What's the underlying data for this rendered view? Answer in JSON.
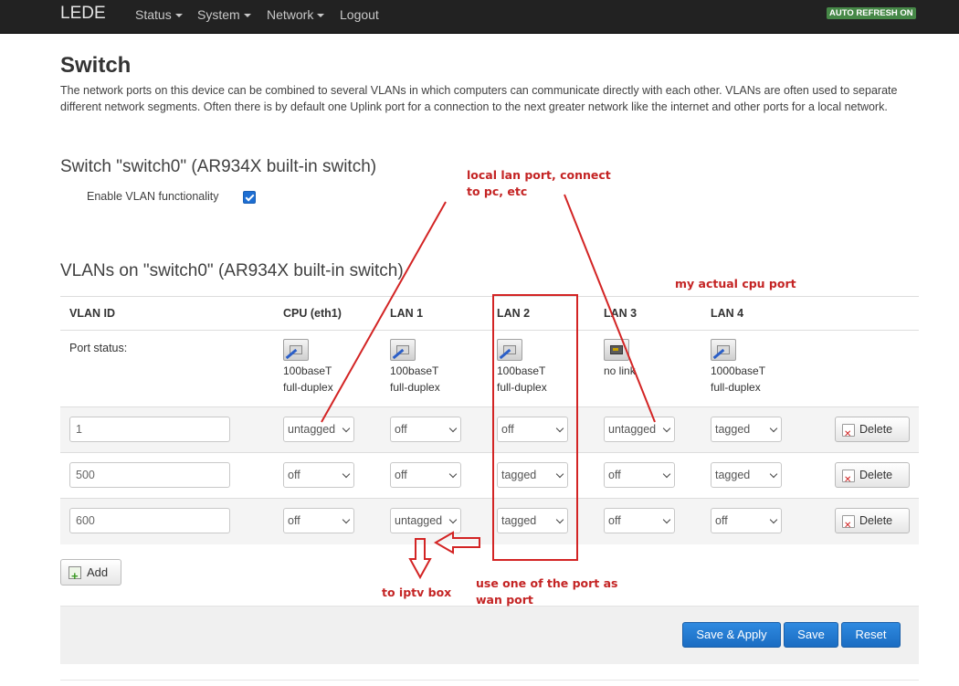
{
  "navbar": {
    "brand": "LEDE",
    "menu": [
      {
        "label": "Status",
        "dropdown": true
      },
      {
        "label": "System",
        "dropdown": true
      },
      {
        "label": "Network",
        "dropdown": true
      },
      {
        "label": "Logout",
        "dropdown": false
      }
    ],
    "auto_refresh": "AUTO REFRESH ON"
  },
  "page": {
    "title": "Switch",
    "description": "The network ports on this device can be combined to several VLANs in which computers can communicate directly with each other. VLANs are often used to separate different network segments. Often there is by default one Uplink port for a connection to the next greater network like the internet and other ports for a local network."
  },
  "switch_section": {
    "title": "Switch \"switch0\" (AR934X built-in switch)",
    "vlan_option_label": "Enable VLAN functionality",
    "vlan_enabled": true
  },
  "vlans_section": {
    "title": "VLANs on \"switch0\" (AR934X built-in switch)",
    "columns": [
      "VLAN ID",
      "CPU (eth1)",
      "LAN 1",
      "LAN 2",
      "LAN 3",
      "LAN 4"
    ],
    "port_status_label": "Port status:",
    "port_status": [
      {
        "speed": "100baseT",
        "duplex": "full-duplex",
        "linked": true
      },
      {
        "speed": "100baseT",
        "duplex": "full-duplex",
        "linked": true
      },
      {
        "speed": "100baseT",
        "duplex": "full-duplex",
        "linked": true
      },
      {
        "speed": "no link",
        "duplex": "",
        "linked": false
      },
      {
        "speed": "1000baseT",
        "duplex": "full-duplex",
        "linked": true
      }
    ],
    "rows": [
      {
        "vlan_id": "1",
        "ports": [
          "untagged",
          "off",
          "off",
          "untagged",
          "tagged"
        ]
      },
      {
        "vlan_id": "500",
        "ports": [
          "off",
          "off",
          "tagged",
          "off",
          "tagged"
        ]
      },
      {
        "vlan_id": "600",
        "ports": [
          "off",
          "untagged",
          "tagged",
          "off",
          "off"
        ]
      }
    ],
    "delete_label": "Delete",
    "add_label": "Add"
  },
  "actions": {
    "save_apply": "Save & Apply",
    "save": "Save",
    "reset": "Reset"
  },
  "annotations": {
    "local_lan": "local lan port, connect\nto pc, etc",
    "cpu_port": "my actual cpu port",
    "wan_port": "use one of the port as\nwan port",
    "iptv": "to iptv box",
    "color": "#d32424"
  }
}
